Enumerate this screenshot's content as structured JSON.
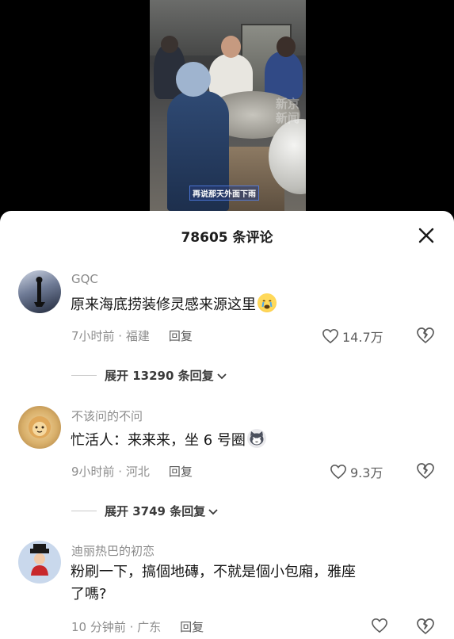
{
  "video": {
    "watermark": "新京 新闻",
    "subtitle": "再说那天外面下雨"
  },
  "header": {
    "comment_count_label": "78605 条评论"
  },
  "comments": [
    {
      "username": "GQC",
      "text": "原来海底捞装修灵感来源这里",
      "emoji": "crying-face-emoji",
      "time_location": "7小时前 · 福建",
      "reply_label": "回复",
      "likes": "14.7万",
      "expand_label": "展开 13290 条回复"
    },
    {
      "username": "不该问的不问",
      "text": "忙活人：来来来，坐 6 号圈",
      "emoji": "cat-face-emoji",
      "time_location": "9小时前 · 河北",
      "reply_label": "回复",
      "likes": "9.3万",
      "expand_label": "展开 3749 条回复"
    },
    {
      "username": "迪丽热巴的初恋",
      "text_line1": "粉刷一下，搞個地磚，不就是個小包廂，雅座",
      "text_line2": "了嗎?",
      "time_location": "10 分钟前 · 广东",
      "reply_label": "回复"
    }
  ],
  "colors": {
    "background": "#ffffff",
    "video_bg": "#000000",
    "muted_text": "#8b8b8b"
  }
}
